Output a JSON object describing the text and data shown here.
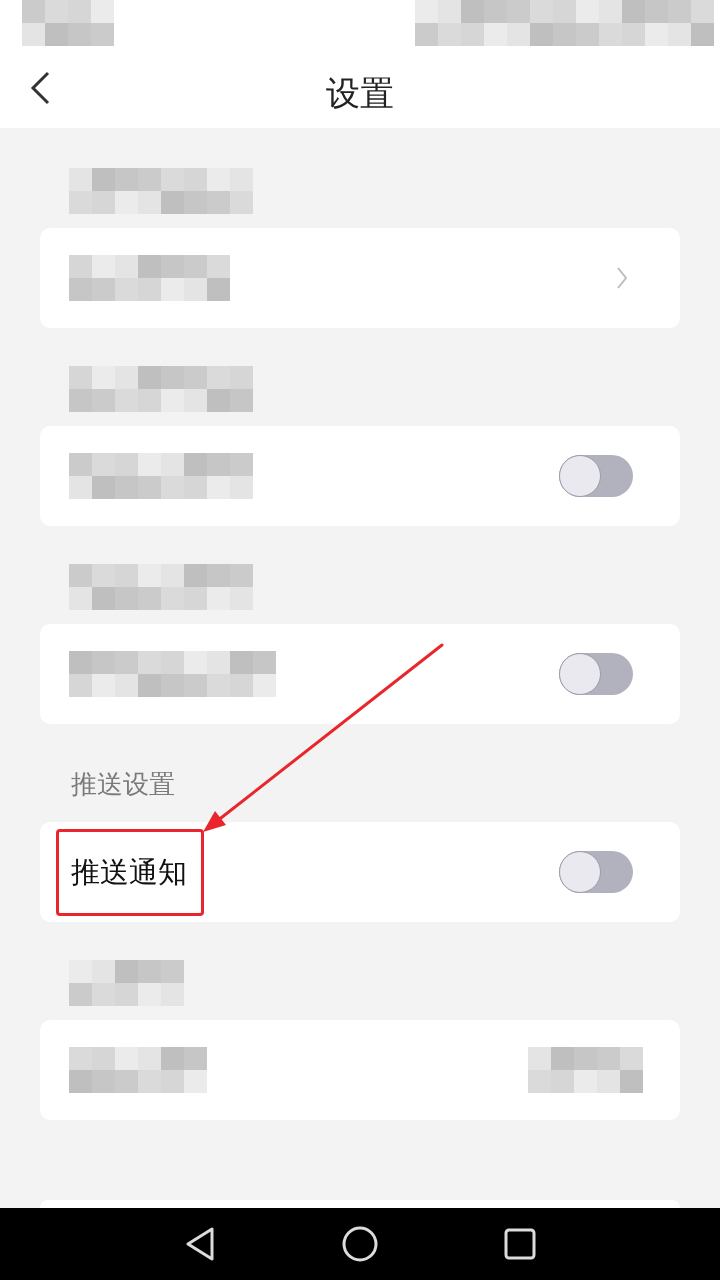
{
  "status_bar": {
    "left": {
      "kind": "tiny"
    },
    "right": {
      "kind": "wide"
    }
  },
  "header": {
    "back_button": true,
    "title": "设置"
  },
  "sections": [
    {
      "kind": "group",
      "title": {
        "kind": "longer"
      },
      "rows": [
        {
          "kind": "chevron",
          "label": {
            "kind": "long"
          },
          "highlighted": false
        }
      ]
    },
    {
      "kind": "group",
      "title": {
        "kind": "longer"
      },
      "rows": [
        {
          "kind": "toggle",
          "label": {
            "kind": "longer"
          },
          "on": false,
          "highlighted": false
        }
      ]
    },
    {
      "kind": "group",
      "title": {
        "kind": "longer"
      },
      "rows": [
        {
          "kind": "toggle",
          "label": {
            "kind": "longest"
          },
          "on": false,
          "highlighted": false
        }
      ]
    },
    {
      "kind": "group",
      "title": {
        "kind": "text",
        "text": "推送设置"
      },
      "rows": [
        {
          "kind": "toggle",
          "label": {
            "kind": "text",
            "text": "推送通知"
          },
          "on": false,
          "highlighted": true
        }
      ]
    },
    {
      "kind": "group",
      "title": {
        "kind": "short"
      },
      "rows": [
        {
          "kind": "value",
          "label": {
            "kind": "medium"
          },
          "value": {
            "kind": "short"
          },
          "highlighted": false
        }
      ]
    },
    {
      "kind": "cutoff"
    }
  ],
  "navigation_bar": [
    {
      "kind": "back"
    },
    {
      "kind": "home"
    },
    {
      "kind": "recents"
    }
  ]
}
